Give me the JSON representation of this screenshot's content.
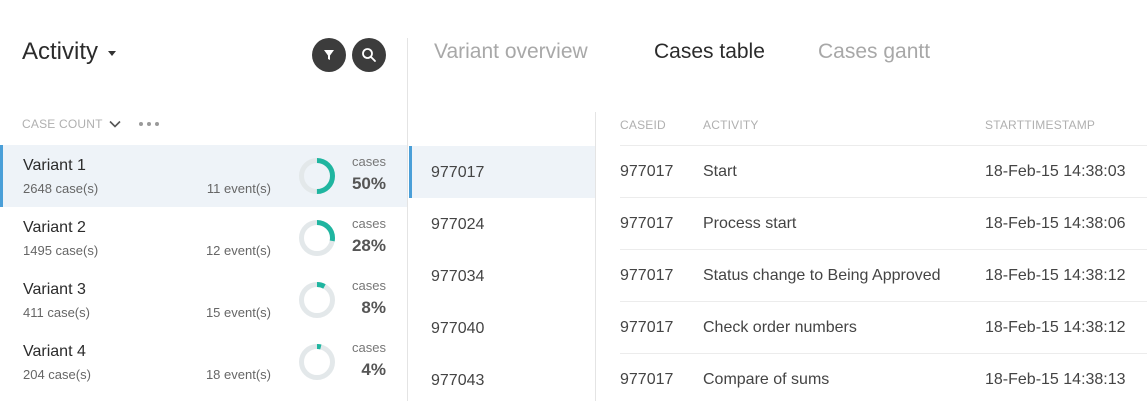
{
  "activity": {
    "title": "Activity"
  },
  "sort": {
    "label": "CASE COUNT"
  },
  "variants": [
    {
      "name": "Variant 1",
      "cases": "2648 case(s)",
      "events": "11 event(s)",
      "cases_label": "cases",
      "percent": "50%",
      "fraction": 0.5
    },
    {
      "name": "Variant 2",
      "cases": "1495 case(s)",
      "events": "12 event(s)",
      "cases_label": "cases",
      "percent": "28%",
      "fraction": 0.28
    },
    {
      "name": "Variant 3",
      "cases": "411 case(s)",
      "events": "15 event(s)",
      "cases_label": "cases",
      "percent": "8%",
      "fraction": 0.08
    },
    {
      "name": "Variant 4",
      "cases": "204 case(s)",
      "events": "18 event(s)",
      "cases_label": "cases",
      "percent": "4%",
      "fraction": 0.04
    }
  ],
  "tabs": [
    {
      "label": "Variant overview",
      "active": false
    },
    {
      "label": "Cases table",
      "active": true
    },
    {
      "label": "Cases gantt",
      "active": false
    }
  ],
  "case_ids": [
    "977017",
    "977024",
    "977034",
    "977040",
    "977043"
  ],
  "table": {
    "headers": [
      "CASEID",
      "ACTIVITY",
      "STARTTIMESTAMP"
    ],
    "rows": [
      [
        "977017",
        "Start",
        "18-Feb-15 14:38:03"
      ],
      [
        "977017",
        "Process start",
        "18-Feb-15 14:38:06"
      ],
      [
        "977017",
        "Status change to Being Approved",
        "18-Feb-15 14:38:12"
      ],
      [
        "977017",
        "Check order numbers",
        "18-Feb-15 14:38:12"
      ],
      [
        "977017",
        "Compare of sums",
        "18-Feb-15 14:38:13"
      ]
    ]
  },
  "colors": {
    "accent": "#4a9fd8",
    "donut_fill": "#1fb5a0",
    "donut_track": "#e3e8ea",
    "selected_bg": "#eef3f8",
    "button_bg": "#3c3c3c"
  },
  "icons": {
    "filter": "filter-icon",
    "search": "search-icon",
    "caret": "caret-down-icon",
    "chevron": "chevron-down-icon",
    "more": "more-icon"
  }
}
